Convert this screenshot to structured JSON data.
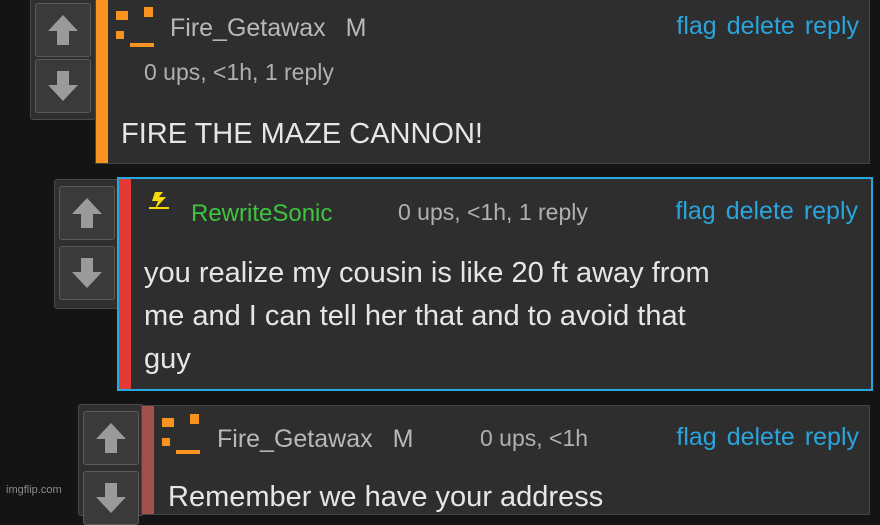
{
  "comments": [
    {
      "username": "Fire_Getawax",
      "badge": "M",
      "meta": "0 ups, <1h, 1 reply",
      "text": "FIRE THE MAZE CANNON!",
      "stripe_color": "#f7931e"
    },
    {
      "username": "RewriteSonic",
      "badge": "",
      "meta": "0 ups, <1h, 1 reply",
      "text_lines": [
        "you realize my cousin is like 20 ft away from",
        "me and I can tell her that and to avoid that",
        "guy"
      ],
      "stripe_color": "#e53935",
      "username_color": "#3ec43e"
    },
    {
      "username": "Fire_Getawax",
      "badge": "M",
      "meta": "0 ups, <1h",
      "text": "Remember we have your address",
      "stripe_color": "#a0524a"
    }
  ],
  "actions": {
    "flag": "flag",
    "delete": "delete",
    "reply": "reply"
  },
  "icons": {
    "upvote": "arrow-up-icon",
    "downvote": "arrow-down-icon",
    "avatar_orange": "orange-glyph-avatar",
    "avatar_yellow": "lightning-avatar"
  },
  "colors": {
    "link": "#2aa4dc",
    "highlight_border": "#28a8e0"
  },
  "watermark": "imgflip.com"
}
